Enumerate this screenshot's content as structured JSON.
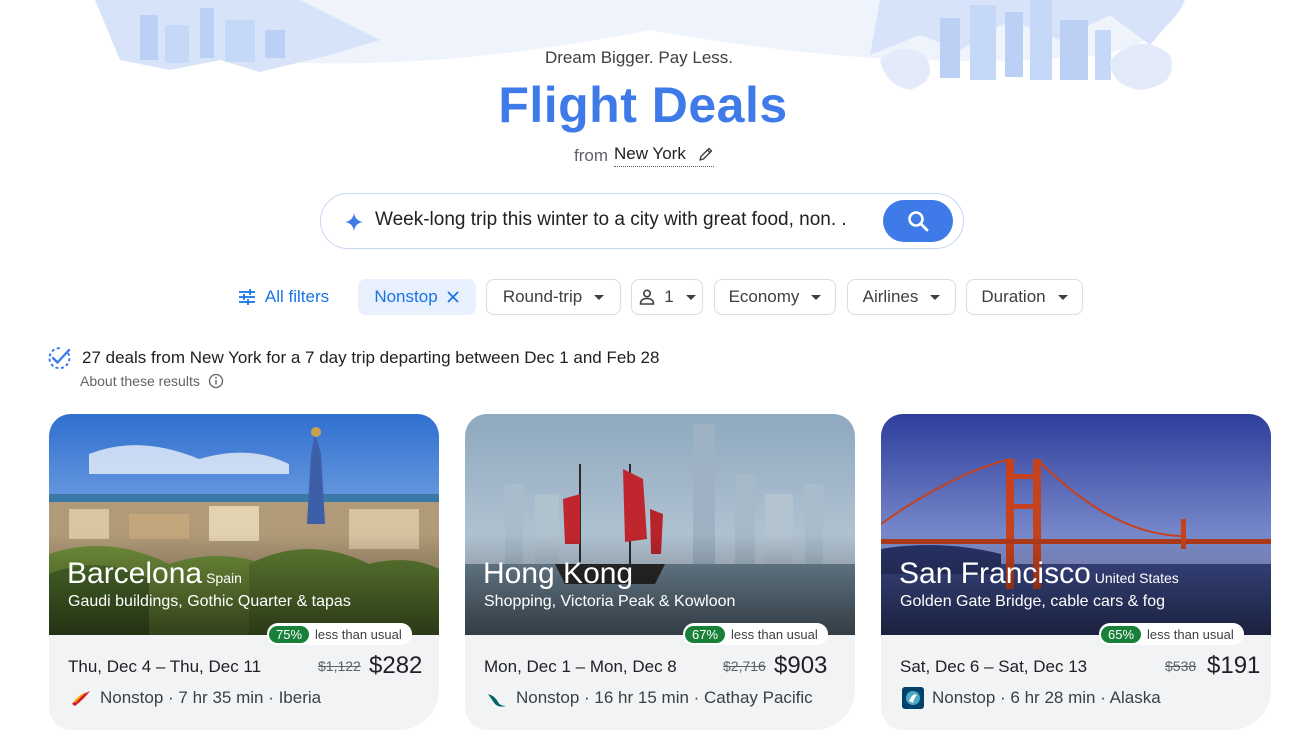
{
  "header": {
    "tagline": "Dream Bigger. Pay Less.",
    "title": "Flight Deals",
    "from_label": "from",
    "from_city": "New York"
  },
  "search": {
    "query": "Week-long trip this winter to a city with great food, non. ."
  },
  "filters": {
    "all_filters": "All filters",
    "nonstop": "Nonstop",
    "trip_type": "Round-trip",
    "passengers": "1",
    "cabin": "Economy",
    "airlines": "Airlines",
    "duration": "Duration"
  },
  "results": {
    "summary_bold": "27 deals from New York",
    "summary_rest": " for a 7 day trip departing between Dec 1 and Feb 28",
    "about": "About these results"
  },
  "deals": [
    {
      "city": "Barcelona",
      "country": "Spain",
      "subtitle": "Gaudi buildings, Gothic Quarter & tapas",
      "discount": "75%",
      "less_label": "less than usual",
      "dates": "Thu, Dec 4 – Thu, Dec 11",
      "old_price": "$1,122",
      "price": "$282",
      "flight": "Nonstop · 7 hr 35 min · Iberia",
      "airline_icon": "iberia-logo-icon"
    },
    {
      "city": "Hong Kong",
      "country": "",
      "subtitle": "Shopping, Victoria Peak & Kowloon",
      "discount": "67%",
      "less_label": "less than usual",
      "dates": "Mon, Dec 1 – Mon, Dec 8",
      "old_price": "$2,716",
      "price": "$903",
      "flight": "Nonstop · 16 hr 15 min · Cathay Pacific",
      "airline_icon": "cathay-pacific-logo-icon"
    },
    {
      "city": "San Francisco",
      "country": "United States",
      "subtitle": "Golden Gate Bridge, cable cars & fog",
      "discount": "65%",
      "less_label": "less than usual",
      "dates": "Sat, Dec 6 – Sat, Dec 13",
      "old_price": "$538",
      "price": "$191",
      "flight": "Nonstop · 6 hr 28 min · Alaska",
      "airline_icon": "alaska-logo-icon"
    }
  ],
  "colors": {
    "accent": "#3e7be8",
    "badge_green": "#188038",
    "card_body": "#f1f3f4"
  }
}
